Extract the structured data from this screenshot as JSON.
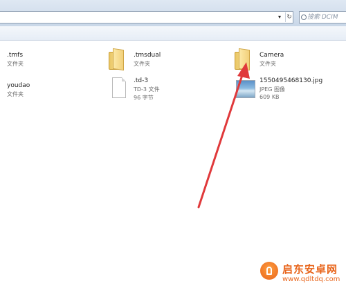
{
  "address_bar": {
    "dropdown_icon": "chevron-down-icon",
    "refresh_icon": "refresh-icon"
  },
  "search": {
    "placeholder": "搜索 DCIM",
    "icon": "search-icon"
  },
  "files": [
    {
      "name": ".tmfs",
      "type": "文件夹",
      "size": "",
      "icon": "folder-icon"
    },
    {
      "name": ".tmsdual",
      "type": "文件夹",
      "size": "",
      "icon": "folder-icon"
    },
    {
      "name": "Camera",
      "type": "文件夹",
      "size": "",
      "icon": "folder-icon"
    },
    {
      "name": "youdao",
      "type": "文件夹",
      "size": "",
      "icon": "folder-icon"
    },
    {
      "name": ".td-3",
      "type": "TD-3 文件",
      "size": "96 字节",
      "icon": "document-icon"
    },
    {
      "name": "1550495468130.jpg",
      "type": "JPEG 图像",
      "size": "609 KB",
      "icon": "image-icon"
    }
  ],
  "annotation": {
    "color": "#e0393b",
    "target": "Camera"
  },
  "watermark": {
    "title": "启东安卓网",
    "url": "www.qdltdq.com",
    "accent": "#e8641a"
  }
}
